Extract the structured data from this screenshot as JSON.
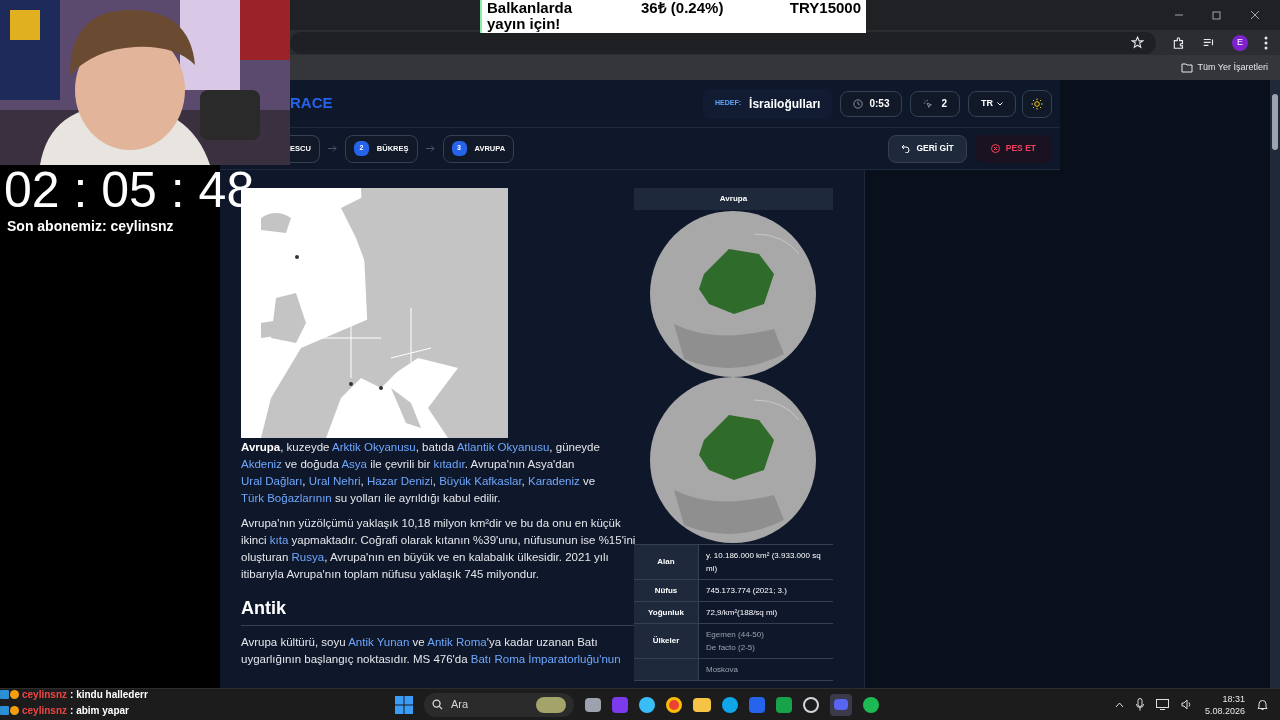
{
  "browser": {
    "bookmarks_label": "Tüm Yer İşaretleri",
    "profile_initial": "E"
  },
  "donation_banner": {
    "message": "Balkanlarda yayın için!",
    "amount": "36₺ (0.24%)",
    "goal": "TRY15000"
  },
  "stream_overlay": {
    "timer": "02 : 05 : 48",
    "last_subscriber": "Son abonemiz: ceylinsnz"
  },
  "game_header": {
    "logo": "RACE",
    "target_label": "HEDEF:",
    "target": "İsrailoğulları",
    "time": "0:53",
    "clicks": "2",
    "language": "TR"
  },
  "path": [
    {
      "label": "ESCU"
    },
    {
      "number": "2",
      "label": "BÜKREŞ"
    },
    {
      "number": "3",
      "label": "AVRUPA"
    }
  ],
  "actions": [
    {
      "kind": "back",
      "label": "GERİ GİT"
    },
    {
      "kind": "give_up",
      "label": "PES ET"
    }
  ],
  "article": {
    "blocks": [
      {
        "kind": "paragraph",
        "segments": [
          {
            "kind": "text",
            "text": "**Avrupa**, kuzeyde "
          },
          {
            "kind": "link",
            "text": "Arktik Okyanusu"
          },
          {
            "kind": "text",
            "text": ", batıda "
          },
          {
            "kind": "link",
            "text": "Atlantik Okyanusu"
          },
          {
            "kind": "text",
            "text": ", güneyde "
          },
          {
            "kind": "link",
            "text": "Akdeniz"
          },
          {
            "kind": "text",
            "text": " ve doğuda "
          },
          {
            "kind": "link",
            "text": "Asya"
          },
          {
            "kind": "text",
            "text": " ile çevrili bir "
          },
          {
            "kind": "link",
            "text": "kıtadır"
          },
          {
            "kind": "text",
            "text": ". Avrupa'nın Asya'dan "
          },
          {
            "kind": "link",
            "text": "Ural Dağları"
          },
          {
            "kind": "text",
            "text": ", "
          },
          {
            "kind": "link",
            "text": "Ural Nehri"
          },
          {
            "kind": "text",
            "text": ", "
          },
          {
            "kind": "link",
            "text": "Hazar Denizi"
          },
          {
            "kind": "text",
            "text": ", "
          },
          {
            "kind": "link",
            "text": "Büyük Kafkaslar"
          },
          {
            "kind": "text",
            "text": ", "
          },
          {
            "kind": "link",
            "text": "Karadeniz"
          },
          {
            "kind": "text",
            "text": " ve "
          },
          {
            "kind": "link",
            "text": "Türk Boğazlarının"
          },
          {
            "kind": "text",
            "text": " su yolları ile ayrıldığı kabul edilir."
          }
        ]
      },
      {
        "kind": "paragraph",
        "segments": [
          {
            "kind": "text",
            "text": "Avrupa'nın yüzölçümü yaklaşık 10,18 milyon km²dir ve bu da onu en küçük ikinci "
          },
          {
            "kind": "link",
            "text": "kıta"
          },
          {
            "kind": "text",
            "text": " yapmaktadır. Coğrafi olarak kıtanın %39'unu, nüfusunun ise %15'ini oluşturan "
          },
          {
            "kind": "link",
            "text": "Rusya"
          },
          {
            "kind": "text",
            "text": ", Avrupa'nın en büyük ve en kalabalık ülkesidir. 2021 yılı itibarıyla Avrupa'nın toplam nüfusu yaklaşık 745 milyondur."
          }
        ]
      },
      {
        "kind": "heading",
        "text": "Antik"
      },
      {
        "kind": "paragraph",
        "segments": [
          {
            "kind": "text",
            "text": "Avrupa kültürü, soyu "
          },
          {
            "kind": "link",
            "text": "Antik Yunan"
          },
          {
            "kind": "text",
            "text": " ve "
          },
          {
            "kind": "link",
            "text": "Antik Roma"
          },
          {
            "kind": "text",
            "text": "'ya kadar uzanan Batı uygarlığının başlangıç noktasıdır. MS 476'da "
          },
          {
            "kind": "link",
            "text": "Batı Roma İmparatorluğu'nun"
          }
        ]
      }
    ]
  },
  "infobox": {
    "title": "Avrupa",
    "rows": [
      {
        "label": "Alan",
        "kind": "plain",
        "lines": [
          "y. 10.186.000 km² (3.933.000 sq mi)"
        ]
      },
      {
        "label": "Nüfus",
        "kind": "plain",
        "lines": [
          "745.173.774 (2021; 3.)"
        ]
      },
      {
        "label": "Yoğunluk",
        "kind": "plain",
        "lines": [
          "72,9/km²(188/sq mi)"
        ]
      },
      {
        "label": "Ülkeler",
        "kind": "list",
        "lines": [
          "Egemen (44-50)",
          "De facto (2-5)"
        ]
      },
      {
        "kind": "list",
        "lines": [
          "Moskova"
        ]
      }
    ]
  },
  "chat": [
    {
      "user": "ceylinsnz",
      "text": ": kindu hallederr"
    },
    {
      "user": "ceylinsnz",
      "text": ": abim yapar"
    }
  ],
  "taskbar": {
    "search_placeholder": "Ara",
    "time": "18:31",
    "date": "5.08.2026"
  }
}
